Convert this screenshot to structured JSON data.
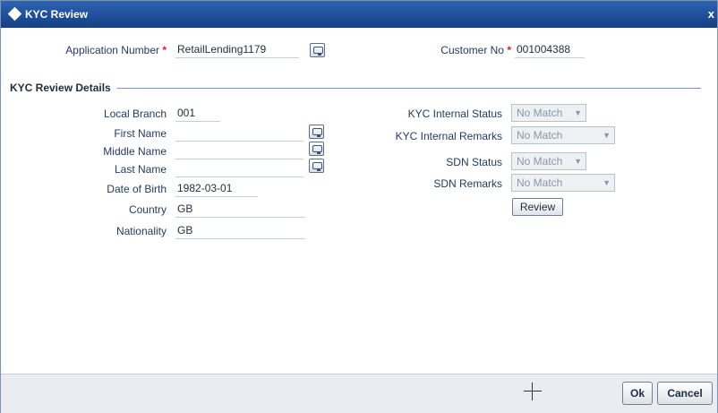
{
  "window": {
    "title": "KYC Review",
    "close_glyph": "x"
  },
  "header": {
    "application_number_label": "Application Number",
    "application_number_value": "RetailLending1179",
    "customer_no_label": "Customer No",
    "customer_no_value": "001004388",
    "required_mark": "*"
  },
  "section": {
    "title": "KYC Review Details"
  },
  "left_fields": {
    "local_branch": {
      "label": "Local Branch",
      "value": "001"
    },
    "first_name": {
      "label": "First Name",
      "value": ""
    },
    "middle_name": {
      "label": "Middle Name",
      "value": ""
    },
    "last_name": {
      "label": "Last Name",
      "value": ""
    },
    "date_of_birth": {
      "label": "Date of Birth",
      "value": "1982-03-01"
    },
    "country": {
      "label": "Country",
      "value": "GB"
    },
    "nationality": {
      "label": "Nationality",
      "value": "GB"
    }
  },
  "right_fields": {
    "kyc_internal_status": {
      "label": "KYC Internal Status",
      "value": "No Match"
    },
    "kyc_internal_remarks": {
      "label": "KYC Internal Remarks",
      "value": "No Match"
    },
    "sdn_status": {
      "label": "SDN Status",
      "value": "No Match"
    },
    "sdn_remarks": {
      "label": "SDN Remarks",
      "value": "No Match"
    },
    "review_button": "Review"
  },
  "footer": {
    "ok_label": "Ok",
    "cancel_label": "Cancel"
  },
  "icons": {
    "title_icon": "diamond-icon",
    "lov_icon": "list-of-values-icon",
    "cursor_icon": "crosshair-cursor-icon"
  },
  "colors": {
    "titlebar": "#1f4c9c",
    "required": "#e0201d",
    "footer": "#e9ecf0"
  }
}
